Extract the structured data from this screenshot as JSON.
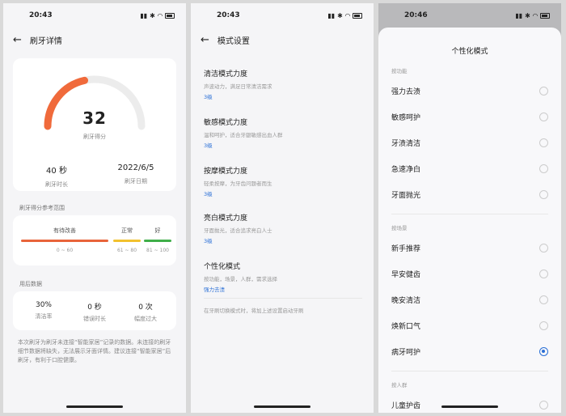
{
  "screen1": {
    "status_time": "20:43",
    "title": "刷牙详情",
    "score": "32",
    "score_label": "刷牙得分",
    "duration_value": "40 秒",
    "duration_label": "刷牙时长",
    "date_value": "2022/6/5",
    "date_label": "刷牙日期",
    "score_progress": 0.32,
    "range_title": "刷牙得分参考范围",
    "ranges": [
      {
        "label": "有待改善",
        "num": "0 ~ 60",
        "color": "#e8643a"
      },
      {
        "label": "正常",
        "num": "61 ~ 80",
        "color": "#f2c12e"
      },
      {
        "label": "好",
        "num": "81 ~ 100",
        "color": "#3fae49"
      }
    ],
    "habit_title": "用后数据",
    "habits": [
      {
        "value": "30%",
        "label": "清洁率"
      },
      {
        "value": "0 秒",
        "label": "错误时长"
      },
      {
        "value": "0 次",
        "label": "幅度过大"
      }
    ],
    "note": "本次刷牙为刷牙未连接“智能家居”记录的数据。未连接的刷牙细节数据将缺失，无法展示牙面详情。建议连接“智能家居”后刷牙，有利于口腔健康。"
  },
  "screen2": {
    "status_time": "20:43",
    "title": "模式设置",
    "modes": [
      {
        "title": "清洁模式力度",
        "desc": "声波动力，满足日常清洁需求",
        "level": "3级"
      },
      {
        "title": "敏感模式力度",
        "desc": "温和呵护，适合牙龈敏感出血人群",
        "level": "3级"
      },
      {
        "title": "按摩模式力度",
        "desc": "轻柔按摩，为牙齿问题者而生",
        "level": "3级"
      },
      {
        "title": "亮白模式力度",
        "desc": "牙面抛光，适合追求亮白人士",
        "level": "3级"
      },
      {
        "title": "个性化模式",
        "desc": "按功能，场景，人群，需求选择",
        "level": "强力去渍"
      }
    ],
    "note": "在牙刷切换模式时，将加上述设置启动牙刷"
  },
  "screen3": {
    "status_time": "20:46",
    "sheet_title": "个性化模式",
    "groups": [
      {
        "label": "按功能",
        "options": [
          "强力去渍",
          "敏感呵护",
          "牙渍清洁",
          "急速净白",
          "牙面抛光"
        ]
      },
      {
        "label": "按场景",
        "options": [
          "新手推荐",
          "早安健齿",
          "晚安清洁",
          "焕新口气",
          "病牙呵护"
        ]
      },
      {
        "label": "按人群",
        "options": [
          "儿童护齿"
        ]
      }
    ],
    "selected": "病牙呵护"
  }
}
